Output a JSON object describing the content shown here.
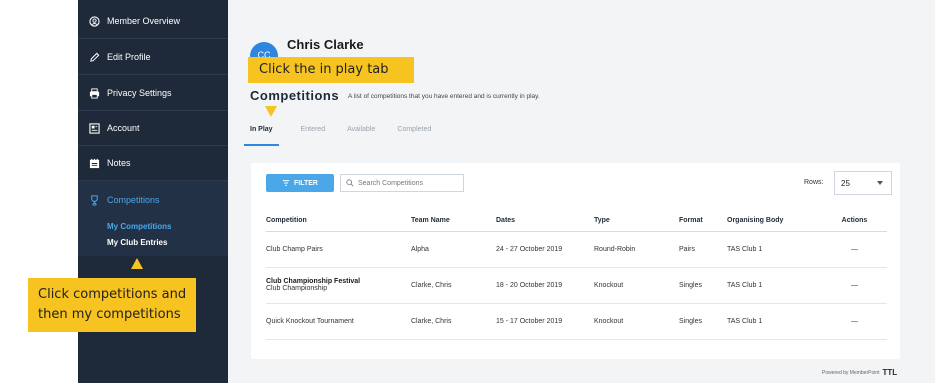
{
  "sidebar": {
    "items": [
      {
        "label": "Member Overview",
        "icon": "user-circle-icon"
      },
      {
        "label": "Edit Profile",
        "icon": "pencil-icon"
      },
      {
        "label": "Privacy Settings",
        "icon": "printer-icon"
      },
      {
        "label": "Account",
        "icon": "account-icon"
      },
      {
        "label": "Notes",
        "icon": "notes-icon"
      }
    ],
    "competitions": {
      "label": "Competitions",
      "icon": "trophy-icon",
      "sub_items": [
        "My Competitions",
        "My Club Entries"
      ]
    }
  },
  "annotations": {
    "left": "Click competitions and then my competitions",
    "top": "Click the in play tab"
  },
  "user": {
    "initials": "CC",
    "name": "Chris Clarke"
  },
  "page": {
    "title": "Competitions",
    "description": "A list of competitions that you have entered and is currently in play."
  },
  "tabs": [
    "In Play",
    "Entered",
    "Available",
    "Completed"
  ],
  "toolbar": {
    "filter_label": "FILTER",
    "search_placeholder": "Search Competitions",
    "rows_label": "Rows:",
    "rows_value": "25"
  },
  "table": {
    "headers": [
      "Competition",
      "Team Name",
      "Dates",
      "Type",
      "Format",
      "Organising Body",
      "Actions"
    ],
    "rows": [
      {
        "competition": "Club Champ Pairs",
        "sub": "",
        "team": "Alpha",
        "dates": "24 - 27 October 2019",
        "type": "Round-Robin",
        "format": "Pairs",
        "body": "TAS Club 1",
        "actions": "—"
      },
      {
        "competition": "Club Championship Festival",
        "sub": "Club Championship",
        "team": "Clarke, Chris",
        "dates": "18 - 20 October 2019",
        "type": "Knockout",
        "format": "Singles",
        "body": "TAS Club 1",
        "actions": "—"
      },
      {
        "competition": "Quick Knockout Tournament",
        "sub": "",
        "team": "Clarke, Chris",
        "dates": "15 - 17 October 2019",
        "type": "Knockout",
        "format": "Singles",
        "body": "TAS Club 1",
        "actions": "—"
      }
    ]
  },
  "footer": {
    "powered_by": "Powered by MemberPoint",
    "mark": "TTL"
  },
  "colors": {
    "sidebar": "#1e2a3a",
    "accent": "#2e86de",
    "highlight": "#4aa8e8",
    "callout": "#f6c320"
  }
}
